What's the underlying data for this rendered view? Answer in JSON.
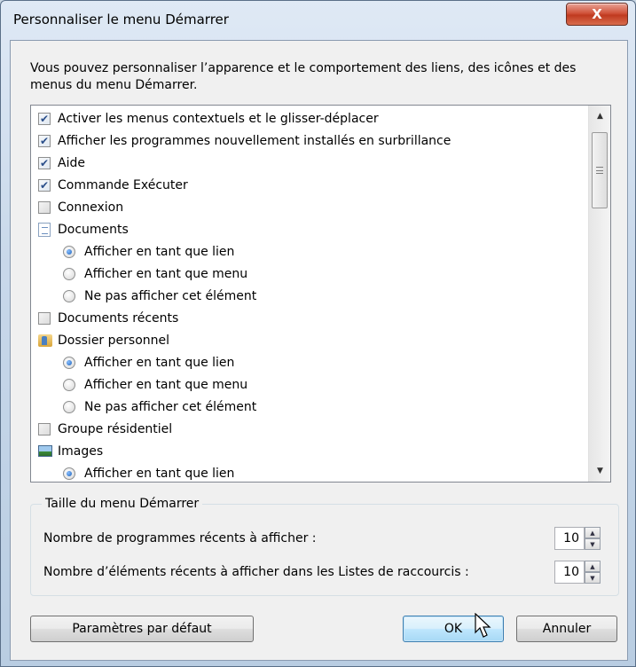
{
  "window": {
    "title": "Personnaliser le menu Démarrer",
    "close_label": "X"
  },
  "description": "Vous pouvez personnaliser l’apparence et le comportement des liens, des icônes et des menus du menu Démarrer.",
  "list": [
    {
      "type": "checkbox",
      "checked": true,
      "label": "Activer les menus contextuels et le glisser-déplacer"
    },
    {
      "type": "checkbox",
      "checked": true,
      "label": "Afficher les programmes nouvellement installés en surbrillance"
    },
    {
      "type": "checkbox",
      "checked": true,
      "label": "Aide"
    },
    {
      "type": "checkbox",
      "checked": true,
      "label": "Commande Exécuter"
    },
    {
      "type": "checkbox",
      "checked": false,
      "label": "Connexion"
    },
    {
      "type": "header",
      "icon": "document-icon",
      "label": "Documents"
    },
    {
      "type": "radio",
      "checked": true,
      "label": "Afficher en tant que lien"
    },
    {
      "type": "radio",
      "checked": false,
      "label": "Afficher en tant que menu"
    },
    {
      "type": "radio",
      "checked": false,
      "label": "Ne pas afficher cet élément"
    },
    {
      "type": "checkbox",
      "checked": false,
      "label": "Documents récents"
    },
    {
      "type": "header",
      "icon": "folder-icon",
      "label": "Dossier personnel"
    },
    {
      "type": "radio",
      "checked": true,
      "label": "Afficher en tant que lien"
    },
    {
      "type": "radio",
      "checked": false,
      "label": "Afficher en tant que menu"
    },
    {
      "type": "radio",
      "checked": false,
      "label": "Ne pas afficher cet élément"
    },
    {
      "type": "checkbox",
      "checked": false,
      "label": "Groupe résidentiel"
    },
    {
      "type": "header",
      "icon": "image-icon",
      "label": "Images"
    },
    {
      "type": "radio",
      "checked": true,
      "label": "Afficher en tant que lien"
    }
  ],
  "size_group": {
    "legend": "Taille du menu Démarrer",
    "recent_programs_label": "Nombre de programmes récents à afficher :",
    "recent_programs_value": "10",
    "jumplist_label": "Nombre d’éléments récents à afficher dans les Listes de raccourcis :",
    "jumplist_value": "10"
  },
  "buttons": {
    "defaults": "Paramètres par défaut",
    "ok": "OK",
    "cancel": "Annuler"
  },
  "colors": {
    "accent": "#3c7fb1",
    "close_red": "#c03a20"
  }
}
